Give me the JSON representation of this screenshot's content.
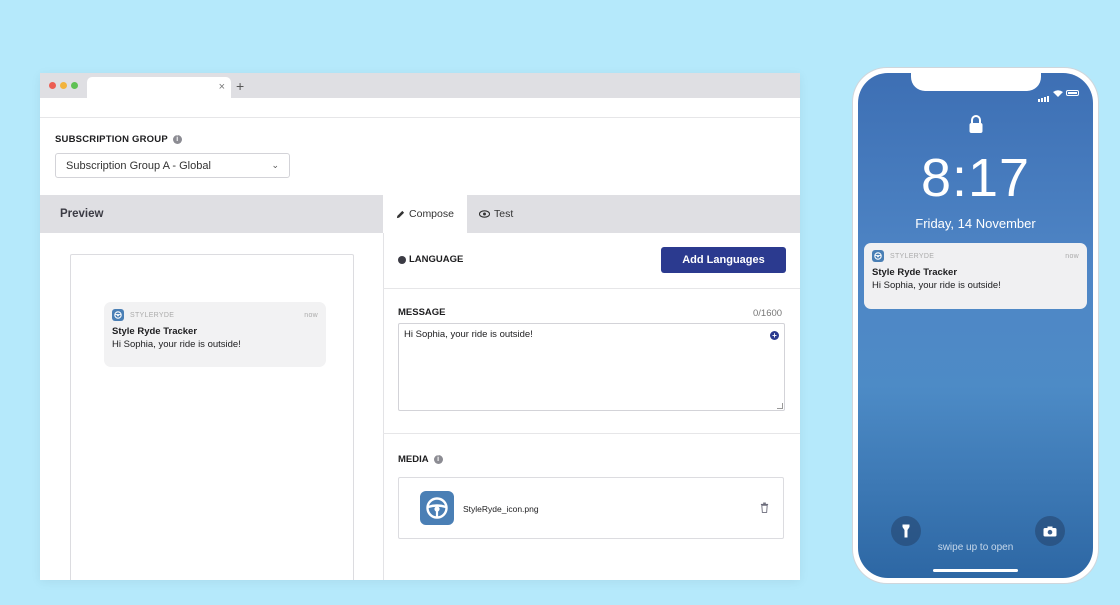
{
  "browser": {
    "tab_close": "×",
    "new_tab": "+"
  },
  "subscription": {
    "label": "SUBSCRIPTION GROUP",
    "selected": "Subscription Group A - Global"
  },
  "preview": {
    "header": "Preview",
    "notification": {
      "app_name": "STYLERYDE",
      "time": "now",
      "title": "Style Ryde Tracker",
      "body": "Hi Sophia, your ride is outside!"
    }
  },
  "tabs": {
    "compose": "Compose",
    "test": "Test"
  },
  "language": {
    "label": "LANGUAGE",
    "add_button": "Add Languages"
  },
  "message": {
    "label": "MESSAGE",
    "count": "0/1600",
    "value": "Hi Sophia, your ride is outside!"
  },
  "media": {
    "label": "MEDIA",
    "file_name": "StyleRyde_icon.png"
  },
  "phone": {
    "time": "8:17",
    "date": "Friday, 14 November",
    "notification": {
      "app_name": "STYLERYDE",
      "time": "now",
      "title": "Style Ryde Tracker",
      "body": "Hi Sophia, your ride is outside!"
    },
    "swipe_text": "swipe up to open"
  },
  "colors": {
    "background": "#b5e9fb",
    "accent": "#2b3a8f",
    "app_icon": "#4a7fb5"
  }
}
